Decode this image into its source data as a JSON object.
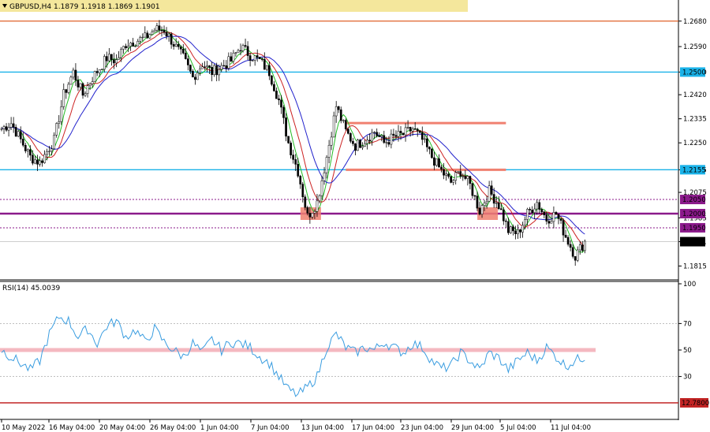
{
  "header": {
    "symbol_line": "GBPUSD,H4  1.1879 1.1918 1.1869 1.1901",
    "highlight_color": "#f4e79c"
  },
  "rsi_header": "RSI(14) 45.0039",
  "colors": {
    "bull_candle": "#000000",
    "bear_candle": "#000000",
    "ma_fast": "#22bb22",
    "ma_mid": "#cc2222",
    "ma_slow": "#2222cc",
    "rsi_line": "#3a9de0",
    "support_cyan": "#1ab2e8",
    "level_purple": "#8b1a8b",
    "range_orange": "#f08070",
    "rsi_band": "#f4b8c0",
    "top_line": "#e0622a",
    "bottom_line": "#c22424"
  },
  "chart_data": [
    {
      "type": "candlestick",
      "name": "GBPUSD,H4",
      "ylim": [
        1.178,
        1.271
      ],
      "y_ticks": [
        "1.2680",
        "1.2590",
        "1.2500",
        "1.2420",
        "1.2335",
        "1.2250",
        "1.2155",
        "1.2075",
        "1.1985",
        "1.1901",
        "1.1815"
      ],
      "y_tick_values": [
        1.268,
        1.259,
        1.25,
        1.242,
        1.2335,
        1.225,
        1.2155,
        1.2075,
        1.1985,
        1.1901,
        1.1815
      ],
      "x_ticks": [
        "10 May 2022",
        "16 May 04:00",
        "20 May 04:00",
        "26 May 04:00",
        "1 Jun 04:00",
        "7 Jun 04:00",
        "13 Jun 04:00",
        "17 Jun 04:00",
        "23 Jun 04:00",
        "29 Jun 04:00",
        "5 Jul 04:00",
        "11 Jul 04:00"
      ],
      "price_key_points": [
        [
          0,
          1.23
        ],
        [
          4,
          1.232
        ],
        [
          8,
          1.226
        ],
        [
          12,
          1.22
        ],
        [
          16,
          1.218
        ],
        [
          22,
          1.226
        ],
        [
          26,
          1.242
        ],
        [
          30,
          1.25
        ],
        [
          34,
          1.242
        ],
        [
          38,
          1.248
        ],
        [
          44,
          1.255
        ],
        [
          48,
          1.254
        ],
        [
          52,
          1.26
        ],
        [
          56,
          1.261
        ],
        [
          60,
          1.262
        ],
        [
          64,
          1.265
        ],
        [
          68,
          1.265
        ],
        [
          72,
          1.26
        ],
        [
          76,
          1.255
        ],
        [
          80,
          1.248
        ],
        [
          84,
          1.253
        ],
        [
          88,
          1.25
        ],
        [
          92,
          1.252
        ],
        [
          96,
          1.254
        ],
        [
          100,
          1.259
        ],
        [
          104,
          1.256
        ],
        [
          108,
          1.254
        ],
        [
          112,
          1.25
        ],
        [
          116,
          1.24
        ],
        [
          120,
          1.225
        ],
        [
          124,
          1.215
        ],
        [
          128,
          1.199
        ],
        [
          132,
          1.204
        ],
        [
          136,
          1.22
        ],
        [
          140,
          1.238
        ],
        [
          144,
          1.229
        ],
        [
          148,
          1.224
        ],
        [
          152,
          1.226
        ],
        [
          156,
          1.229
        ],
        [
          160,
          1.225
        ],
        [
          164,
          1.227
        ],
        [
          168,
          1.228
        ],
        [
          172,
          1.23
        ],
        [
          176,
          1.226
        ],
        [
          180,
          1.22
        ],
        [
          184,
          1.215
        ],
        [
          188,
          1.211
        ],
        [
          192,
          1.215
        ],
        [
          196,
          1.21
        ],
        [
          200,
          1.201
        ],
        [
          204,
          1.208
        ],
        [
          208,
          1.203
        ],
        [
          212,
          1.194
        ],
        [
          216,
          1.193
        ],
        [
          220,
          1.2
        ],
        [
          224,
          1.204
        ],
        [
          228,
          1.198
        ],
        [
          232,
          1.2
        ],
        [
          236,
          1.192
        ],
        [
          240,
          1.185
        ],
        [
          244,
          1.1901
        ]
      ],
      "moving_averages_visible": [
        "fast (green)",
        "medium (red)",
        "slow (blue)"
      ],
      "horizontal_levels": [
        {
          "value": 1.268,
          "label": "1.2680",
          "style": "top-boundary",
          "color": "#e0622a"
        },
        {
          "value": 1.25,
          "label": "1.2500",
          "style": "solid",
          "color": "#1ab2e8"
        },
        {
          "value": 1.2155,
          "label": "1.2155",
          "style": "solid",
          "color": "#1ab2e8"
        },
        {
          "value": 1.205,
          "label": "1.2050",
          "style": "dotted",
          "color": "#8b1a8b"
        },
        {
          "value": 1.2,
          "label": "1.2000",
          "style": "thick",
          "color": "#8b1a8b"
        },
        {
          "value": 1.195,
          "label": "1.1950",
          "style": "dotted",
          "color": "#8b1a8b"
        },
        {
          "value": 1.1901,
          "label": "1.1901",
          "style": "current-price",
          "color": "#000000"
        }
      ],
      "range_box": {
        "from_index": 144,
        "to_index": 211,
        "top": 1.232,
        "bottom": 1.2155,
        "color": "#f08070"
      },
      "highlight_zones": [
        {
          "center_index": 129,
          "value": 1.2,
          "color": "#f08070"
        },
        {
          "center_index": 203,
          "value": 1.2,
          "color": "#f08070"
        }
      ]
    },
    {
      "type": "line",
      "name": "RSI(14)",
      "current_value": 45.0039,
      "ylim": [
        0,
        100
      ],
      "y_ticks": [
        "100",
        "70",
        "50",
        "30"
      ],
      "y_tick_values": [
        100,
        70,
        50,
        30
      ],
      "levels": [
        {
          "value": 70,
          "style": "dotted"
        },
        {
          "value": 50,
          "style": "band",
          "color": "#f4b8c0"
        },
        {
          "value": 30,
          "style": "dotted"
        }
      ],
      "bottom_label": "12.7800",
      "rsi_key_points": [
        [
          0,
          50
        ],
        [
          4,
          45
        ],
        [
          8,
          40
        ],
        [
          12,
          35
        ],
        [
          16,
          42
        ],
        [
          20,
          62
        ],
        [
          24,
          75
        ],
        [
          28,
          72
        ],
        [
          32,
          60
        ],
        [
          36,
          66
        ],
        [
          40,
          55
        ],
        [
          44,
          68
        ],
        [
          48,
          72
        ],
        [
          52,
          60
        ],
        [
          56,
          65
        ],
        [
          60,
          56
        ],
        [
          64,
          66
        ],
        [
          68,
          56
        ],
        [
          72,
          50
        ],
        [
          76,
          45
        ],
        [
          80,
          55
        ],
        [
          84,
          48
        ],
        [
          88,
          58
        ],
        [
          92,
          50
        ],
        [
          96,
          56
        ],
        [
          100,
          55
        ],
        [
          104,
          52
        ],
        [
          108,
          45
        ],
        [
          112,
          40
        ],
        [
          116,
          30
        ],
        [
          120,
          20
        ],
        [
          124,
          16
        ],
        [
          128,
          22
        ],
        [
          132,
          30
        ],
        [
          136,
          52
        ],
        [
          140,
          62
        ],
        [
          144,
          52
        ],
        [
          148,
          48
        ],
        [
          152,
          52
        ],
        [
          156,
          50
        ],
        [
          160,
          56
        ],
        [
          164,
          52
        ],
        [
          168,
          48
        ],
        [
          172,
          55
        ],
        [
          176,
          52
        ],
        [
          180,
          42
        ],
        [
          184,
          36
        ],
        [
          188,
          38
        ],
        [
          192,
          48
        ],
        [
          196,
          42
        ],
        [
          200,
          35
        ],
        [
          204,
          48
        ],
        [
          208,
          44
        ],
        [
          212,
          35
        ],
        [
          216,
          42
        ],
        [
          220,
          48
        ],
        [
          224,
          42
        ],
        [
          228,
          52
        ],
        [
          232,
          45
        ],
        [
          236,
          38
        ],
        [
          240,
          42
        ],
        [
          244,
          45
        ]
      ]
    }
  ]
}
